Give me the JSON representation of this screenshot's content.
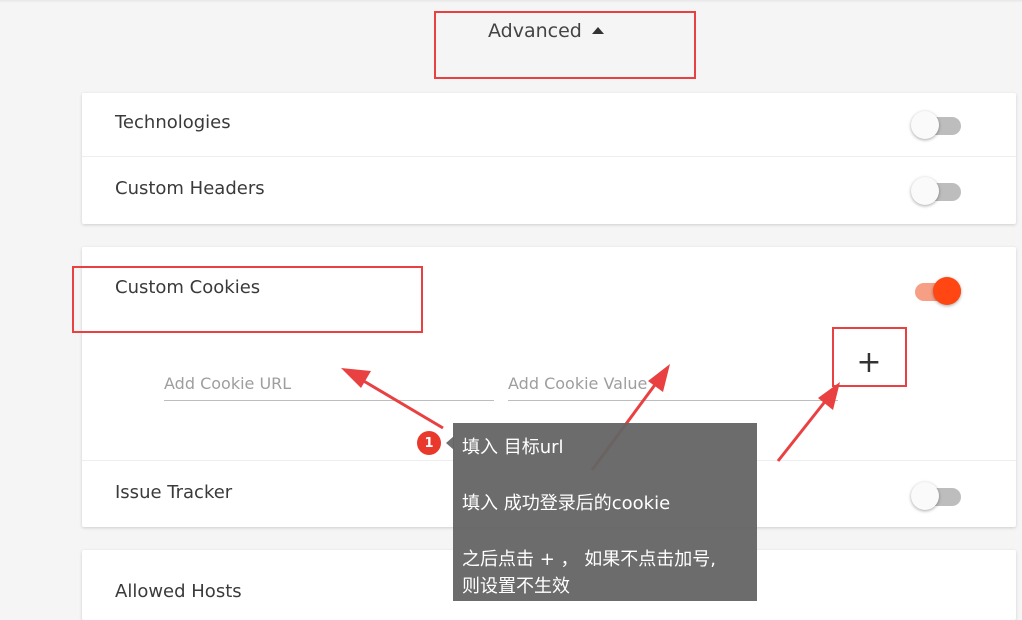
{
  "advanced": {
    "label": "Advanced",
    "icon": "caret-up-icon"
  },
  "sections": {
    "technologies": {
      "label": "Technologies",
      "enabled": false
    },
    "custom_headers": {
      "label": "Custom Headers",
      "enabled": false
    },
    "custom_cookies": {
      "label": "Custom Cookies",
      "enabled": true,
      "url_placeholder": "Add Cookie URL",
      "value_placeholder": "Add Cookie Value",
      "add_symbol": "+"
    },
    "issue_tracker": {
      "label": "Issue Tracker",
      "enabled": false
    },
    "allowed_hosts": {
      "label": "Allowed Hosts"
    }
  },
  "annotation": {
    "badge": "1",
    "lines": [
      "填入  目标url",
      "填入 成功登录后的cookie",
      "之后点击 + ， 如果不点击加号,",
      "则设置不生效"
    ]
  },
  "colors": {
    "accent": "#ff4613",
    "accent_track": "#f79f84",
    "highlight": "#e94041",
    "tooltip_bg": "#646464"
  }
}
